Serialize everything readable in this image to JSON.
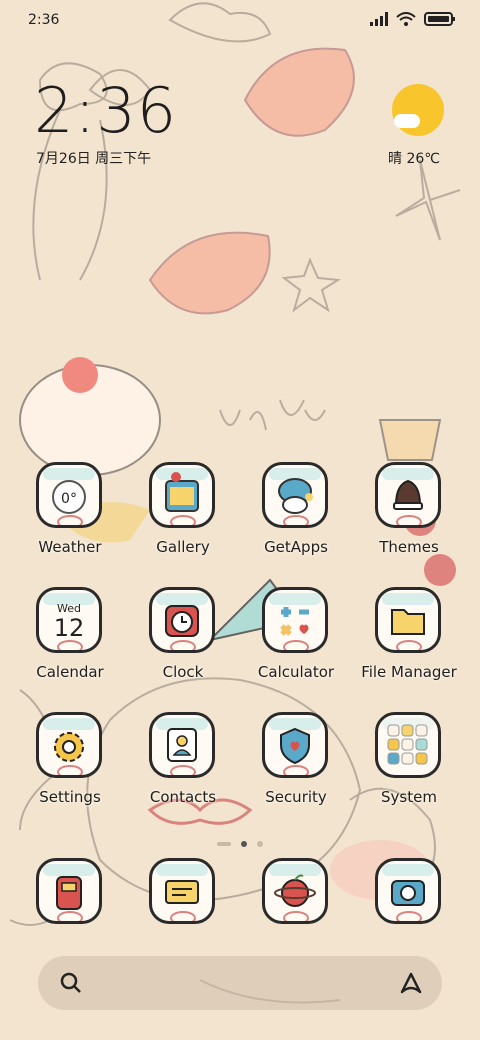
{
  "status_bar": {
    "time": "2:36"
  },
  "clock_widget": {
    "time": "2:36",
    "date": "7月26日 周三下午"
  },
  "weather_widget": {
    "condition_temp": "晴 26℃"
  },
  "apps": [
    {
      "label": "Weather",
      "icon": "weather-icon",
      "badge": "0°"
    },
    {
      "label": "Gallery",
      "icon": "gallery-icon"
    },
    {
      "label": "GetApps",
      "icon": "getapps-icon"
    },
    {
      "label": "Themes",
      "icon": "themes-icon"
    },
    {
      "label": "Calendar",
      "icon": "calendar-icon",
      "day": "Wed",
      "date": "12"
    },
    {
      "label": "Clock",
      "icon": "clock-icon"
    },
    {
      "label": "Calculator",
      "icon": "calculator-icon"
    },
    {
      "label": "File Manager",
      "icon": "file-manager-icon"
    },
    {
      "label": "Settings",
      "icon": "settings-icon"
    },
    {
      "label": "Contacts",
      "icon": "contacts-icon"
    },
    {
      "label": "Security",
      "icon": "security-icon"
    },
    {
      "label": "System",
      "icon": "system-folder-icon"
    }
  ],
  "dock_apps": [
    {
      "icon": "phone-icon"
    },
    {
      "icon": "messages-icon"
    },
    {
      "icon": "browser-icon"
    },
    {
      "icon": "camera-icon"
    }
  ],
  "search_bar": {
    "left_icon": "search-icon",
    "right_icon": "assistant-icon"
  },
  "colors": {
    "background": "#f3e4cf",
    "accent_red": "#d9534f",
    "accent_teal": "#9fd5d1",
    "accent_yellow": "#f8c52c"
  }
}
